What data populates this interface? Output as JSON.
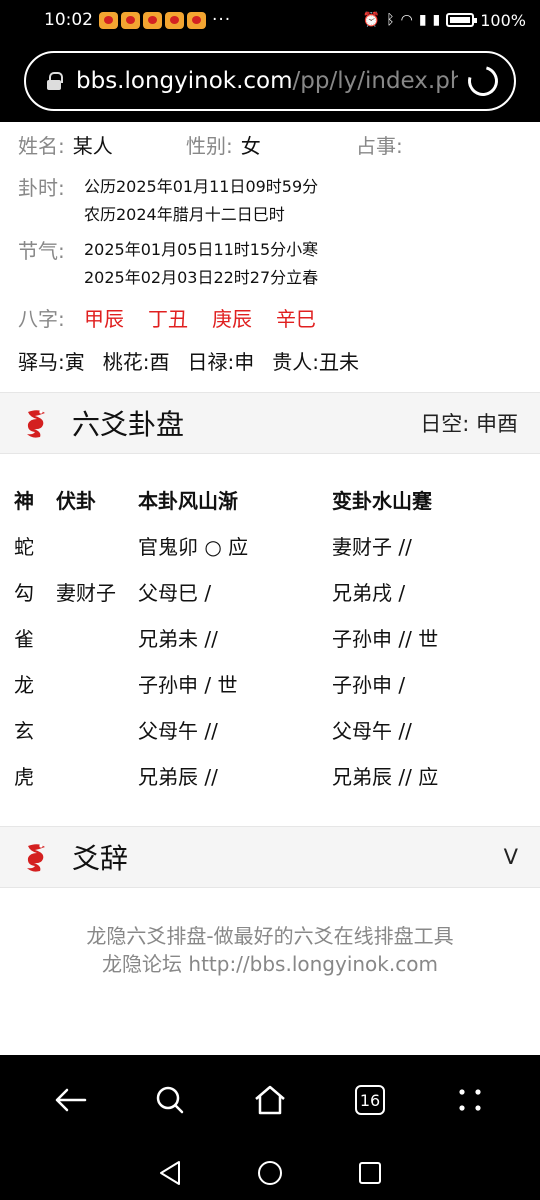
{
  "status": {
    "time": "10:02",
    "more": "···",
    "battery": "100%"
  },
  "browser": {
    "url_host": "bbs.longyinok.com",
    "url_path": "/pp/ly/index.ph",
    "tab_count": "16"
  },
  "info": {
    "name_label": "姓名:",
    "name_value": "某人",
    "gender_label": "性别:",
    "gender_value": "女",
    "matter_label": "占事:",
    "matter_value": "",
    "time_label": "卦时:",
    "time_solar": "公历2025年01月11日09时59分",
    "time_lunar": "农历2024年腊月十二日巳时",
    "term_label": "节气:",
    "term_1": "2025年01月05日11时15分小寒",
    "term_2": "2025年02月03日22时27分立春",
    "bazi_label": "八字:",
    "bazi": [
      "甲辰",
      "丁丑",
      "庚辰",
      "辛巳"
    ],
    "shensha": [
      "驿马:寅",
      "桃花:酉",
      "日禄:申",
      "贵人:丑未"
    ]
  },
  "gua_section": {
    "title": "六爻卦盘",
    "rikong": "日空:  申酉"
  },
  "pan": {
    "headers": [
      "神",
      "伏卦",
      "本卦风山渐",
      "变卦水山蹇"
    ],
    "rows": [
      [
        "蛇",
        "",
        "官鬼卯 ○ 应",
        "妻财子 //"
      ],
      [
        "勾",
        "妻财子",
        "父母巳  /",
        "兄弟戌  /"
      ],
      [
        "雀",
        "",
        "兄弟未 //",
        "子孙申 // 世"
      ],
      [
        "龙",
        "",
        "子孙申  /  世",
        "子孙申  /"
      ],
      [
        "玄",
        "",
        "父母午 //",
        "父母午 //"
      ],
      [
        "虎",
        "",
        "兄弟辰 //",
        "兄弟辰 // 应"
      ]
    ]
  },
  "yaoci_section": {
    "title": "爻辞",
    "toggle": "V"
  },
  "footer": {
    "line1": "龙隐六爻排盘-做最好的六爻在线排盘工具",
    "line2": "龙隐论坛 http://bbs.longyinok.com"
  },
  "colors": {
    "accent_red": "#e02020",
    "label_gray": "#888888"
  }
}
